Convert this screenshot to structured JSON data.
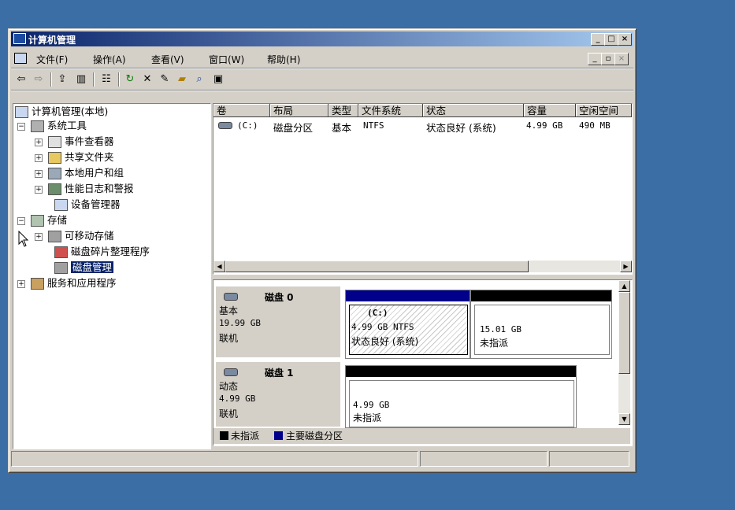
{
  "window": {
    "title": "计算机管理"
  },
  "menu": {
    "items": [
      "文件(F)",
      "操作(A)",
      "查看(V)",
      "窗口(W)",
      "帮助(H)"
    ]
  },
  "toolbar": {
    "icons": [
      "back-arrow-icon",
      "forward-arrow-icon",
      "up-folder-icon",
      "show-hide-tree-icon",
      "properties-icon",
      "refresh-icon",
      "delete-icon",
      "new-icon",
      "open-icon",
      "search-icon",
      "help-icon"
    ]
  },
  "tree": {
    "root": "计算机管理(本地)",
    "system_tools": "系统工具",
    "event_viewer": "事件查看器",
    "shared_folders": "共享文件夹",
    "local_users": "本地用户和组",
    "perf_logs": "性能日志和警报",
    "device_manager": "设备管理器",
    "storage": "存储",
    "removable_storage": "可移动存储",
    "defrag": "磁盘碎片整理程序",
    "disk_management": "磁盘管理",
    "services": "服务和应用程序"
  },
  "volume_table": {
    "headers": [
      "卷",
      "布局",
      "类型",
      "文件系统",
      "状态",
      "容量",
      "空闲空间"
    ],
    "rows": [
      {
        "volume": "(C:)",
        "layout": "磁盘分区",
        "type": "基本",
        "fs": "NTFS",
        "status": "状态良好 (系统)",
        "capacity": "4.99 GB",
        "free": "490 MB"
      }
    ]
  },
  "disks": [
    {
      "name": "磁盘 0",
      "type": "基本",
      "size": "19.99 GB",
      "state": "联机",
      "partitions": [
        {
          "label": "(C:)",
          "detail": "4.99 GB NTFS",
          "status": "状态良好 (系统)"
        },
        {
          "label": "",
          "detail": "15.01 GB",
          "status": "未指派"
        }
      ]
    },
    {
      "name": "磁盘 1",
      "type": "动态",
      "size": "4.99 GB",
      "state": "联机",
      "partitions": [
        {
          "label": "",
          "detail": "4.99 GB",
          "status": "未指派"
        }
      ]
    }
  ],
  "legend": {
    "unallocated": "未指派",
    "primary": "主要磁盘分区"
  },
  "colors": {
    "desktop": "#3a6ea5",
    "title_start": "#0a246a",
    "title_end": "#a6caf0",
    "primary": "#00008b",
    "unallocated": "#000000",
    "selection": "#0a246a"
  }
}
